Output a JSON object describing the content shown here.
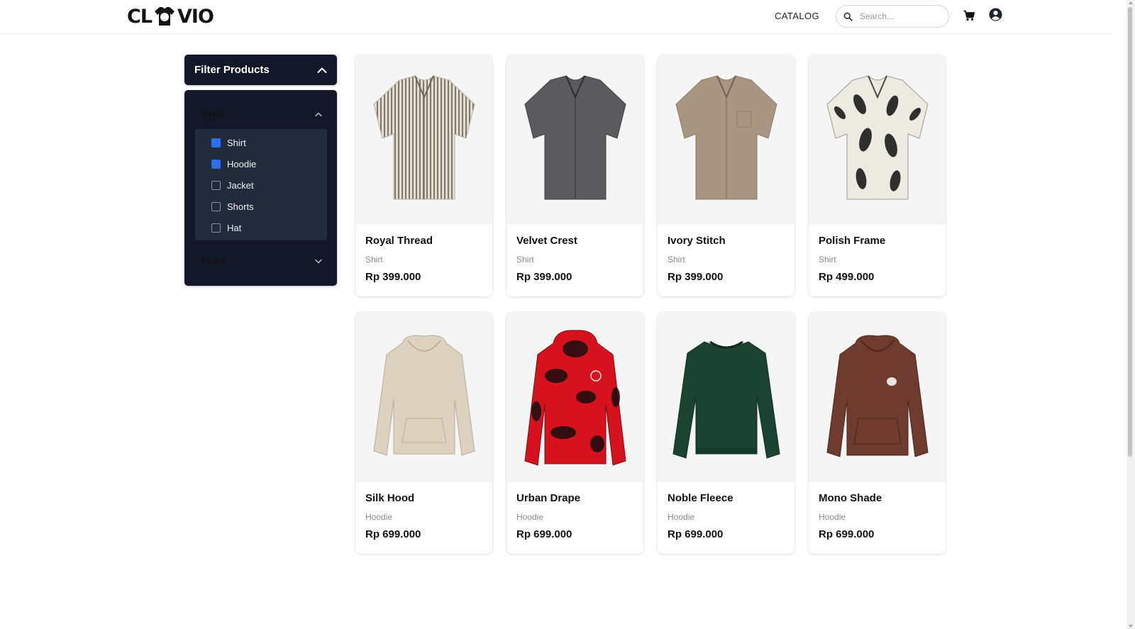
{
  "header": {
    "logo_left": "CL",
    "logo_right": "VIO",
    "nav_catalog": "CATALOG",
    "search_placeholder": "Search...",
    "icons": [
      "search-icon",
      "cart-icon",
      "user-icon"
    ]
  },
  "filter": {
    "title": "Filter Products",
    "type_label": "Type",
    "price_label": "Price",
    "types": [
      {
        "label": "Shirt",
        "checked": true
      },
      {
        "label": "Hoodie",
        "checked": true
      },
      {
        "label": "Jacket",
        "checked": false
      },
      {
        "label": "Shorts",
        "checked": false
      },
      {
        "label": "Hat",
        "checked": false
      }
    ]
  },
  "products": [
    {
      "name": "Royal Thread",
      "category": "Shirt",
      "price": "Rp 399.000"
    },
    {
      "name": "Velvet Crest",
      "category": "Shirt",
      "price": "Rp 399.000"
    },
    {
      "name": "Ivory Stitch",
      "category": "Shirt",
      "price": "Rp 399.000"
    },
    {
      "name": "Polish Frame",
      "category": "Shirt",
      "price": "Rp 499.000"
    },
    {
      "name": "Silk Hood",
      "category": "Hoodie",
      "price": "Rp 699.000"
    },
    {
      "name": "Urban Drape",
      "category": "Hoodie",
      "price": "Rp 699.000"
    },
    {
      "name": "Noble Fleece",
      "category": "Hoodie",
      "price": "Rp 699.000"
    },
    {
      "name": "Mono Shade",
      "category": "Hoodie",
      "price": "Rp 699.000"
    }
  ],
  "colors": {
    "panel": "#121827",
    "panel_list": "#212b3b",
    "checkbox_on": "#2f6fe6"
  }
}
